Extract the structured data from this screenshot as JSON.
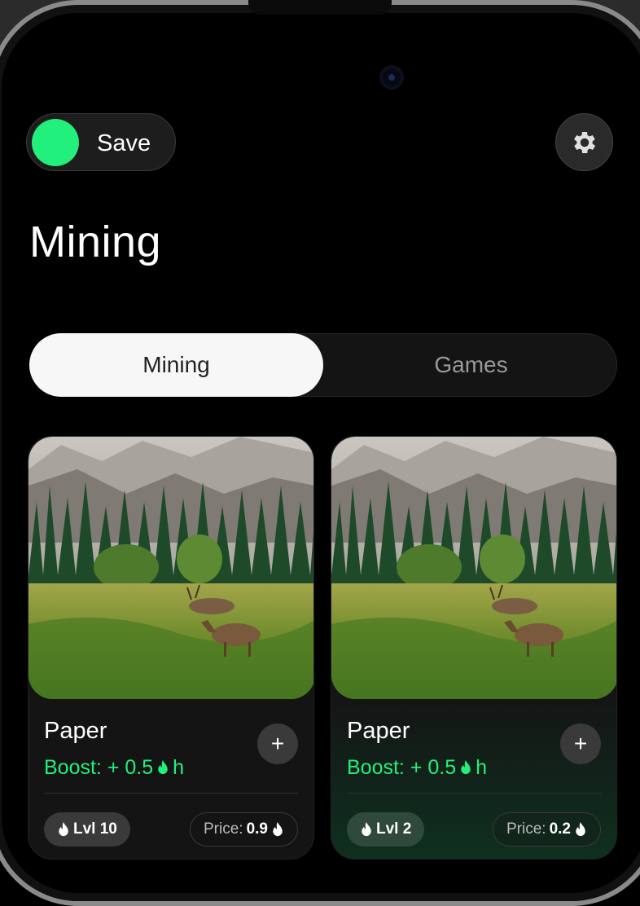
{
  "save_toggle": {
    "label": "Save",
    "state": "on",
    "knob_color": "#22f07c"
  },
  "settings": {
    "icon": "gear-icon"
  },
  "page_title": "Mining",
  "tabs": [
    {
      "label": "Mining",
      "active": true
    },
    {
      "label": "Games",
      "active": false
    }
  ],
  "cards": [
    {
      "name": "Paper",
      "boost_prefix": "Boost: + 0.5",
      "boost_suffix": "h",
      "level": "Lvl 10",
      "price_label": "Price:",
      "price_value": "0.9",
      "image": "forest-meadow-deer"
    },
    {
      "name": "Paper",
      "boost_prefix": "Boost: + 0.5",
      "boost_suffix": "h",
      "level": "Lvl 2",
      "price_label": "Price:",
      "price_value": "0.2",
      "image": "forest-meadow-deer"
    }
  ],
  "colors": {
    "accent": "#22f07c",
    "background": "#000000"
  }
}
